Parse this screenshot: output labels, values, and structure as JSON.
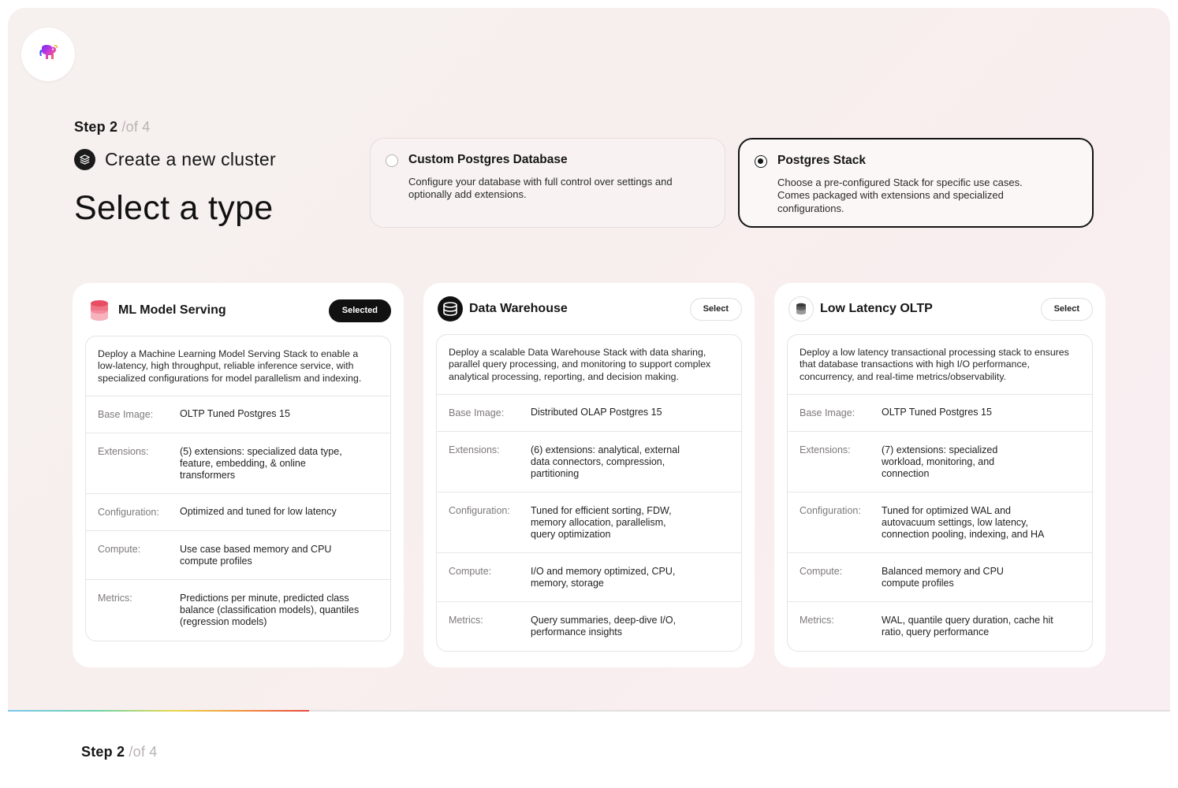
{
  "app": {
    "logo_icon": "elephant-logo-icon"
  },
  "step": {
    "current": "Step 2",
    "total": "/of 4"
  },
  "header": {
    "create_label": "Create a new cluster",
    "create_icon": "stack-layers-icon",
    "title": "Select a type"
  },
  "type_options": [
    {
      "title": "Custom Postgres Database",
      "description": "Configure your database with full control over settings and optionally add extensions.",
      "selected": false
    },
    {
      "title": "Postgres Stack",
      "description": "Choose a pre-configured Stack for specific use cases. Comes packaged with extensions and specialized configurations.",
      "selected": true
    }
  ],
  "labels": {
    "base_image": "Base Image:",
    "extensions": "Extensions:",
    "configuration": "Configuration:",
    "compute": "Compute:",
    "metrics": "Metrics:"
  },
  "stacks": [
    {
      "title": "ML Model Serving",
      "icon": "pink-database-icon",
      "button": "Selected",
      "selected": true,
      "description": "Deploy a Machine Learning Model Serving Stack to enable a low-latency, high throughput, reliable inference service, with specialized configurations for model parallelism and indexing.",
      "base_image": "OLTP Tuned Postgres 15",
      "extensions": "(5) extensions: specialized data type, feature, embedding, & online transformers",
      "configuration": "Optimized and tuned for low latency",
      "compute": "Use case based memory and CPU compute profiles",
      "metrics": "Predictions per minute, predicted class balance (classification models), quantiles (regression models)"
    },
    {
      "title": "Data Warehouse",
      "icon": "black-database-icon",
      "button": "Select",
      "selected": false,
      "description": "Deploy a scalable Data Warehouse Stack with data sharing, parallel query processing, and monitoring to support complex analytical processing, reporting, and decision making.",
      "base_image": "Distributed OLAP Postgres 15",
      "extensions": "(6) extensions: analytical, external data connectors, compression, partitioning",
      "configuration": "Tuned for efficient sorting, FDW, memory allocation, parallelism, query optimization",
      "compute": "I/O and memory optimized, CPU, memory, storage",
      "metrics": "Query summaries, deep-dive I/O, performance insights"
    },
    {
      "title": "Low Latency OLTP",
      "icon": "grey-database-icon",
      "button": "Select",
      "selected": false,
      "description": "Deploy a low latency transactional processing stack to ensures that database transactions with high I/O performance, concurrency, and real-time metrics/observability.",
      "base_image": "OLTP Tuned Postgres 15",
      "extensions": "(7) extensions: specialized workload, monitoring, and connection",
      "configuration": "Tuned for optimized WAL and autovacuum settings, low latency, connection pooling, indexing, and HA",
      "compute": "Balanced memory and CPU compute profiles",
      "metrics": "WAL, quantile query duration, cache hit ratio, query performance"
    }
  ],
  "progress": {
    "fraction": 0.26
  },
  "footer_step": {
    "current": "Step 2",
    "total": "/of 4"
  }
}
